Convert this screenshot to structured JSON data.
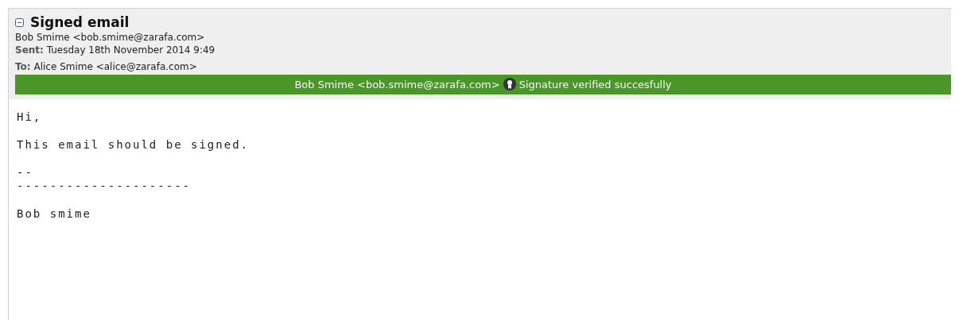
{
  "header": {
    "expanded": true,
    "title": "Signed email",
    "from": "Bob Smime <bob.smime@zarafa.com>",
    "sent": {
      "label": "Sent:",
      "value": "Tuesday 18th November 2014 9:49"
    },
    "to": {
      "label": "To:",
      "value": "Alice Smime <alice@zarafa.com>"
    }
  },
  "signature": {
    "verified": true,
    "signer": "Bob Smime <bob.smime@zarafa.com>",
    "status": "Signature verified succesfully"
  },
  "body": [
    "Hi,",
    "This email should be signed.",
    "--",
    "---------------------",
    "Bob smime"
  ]
}
